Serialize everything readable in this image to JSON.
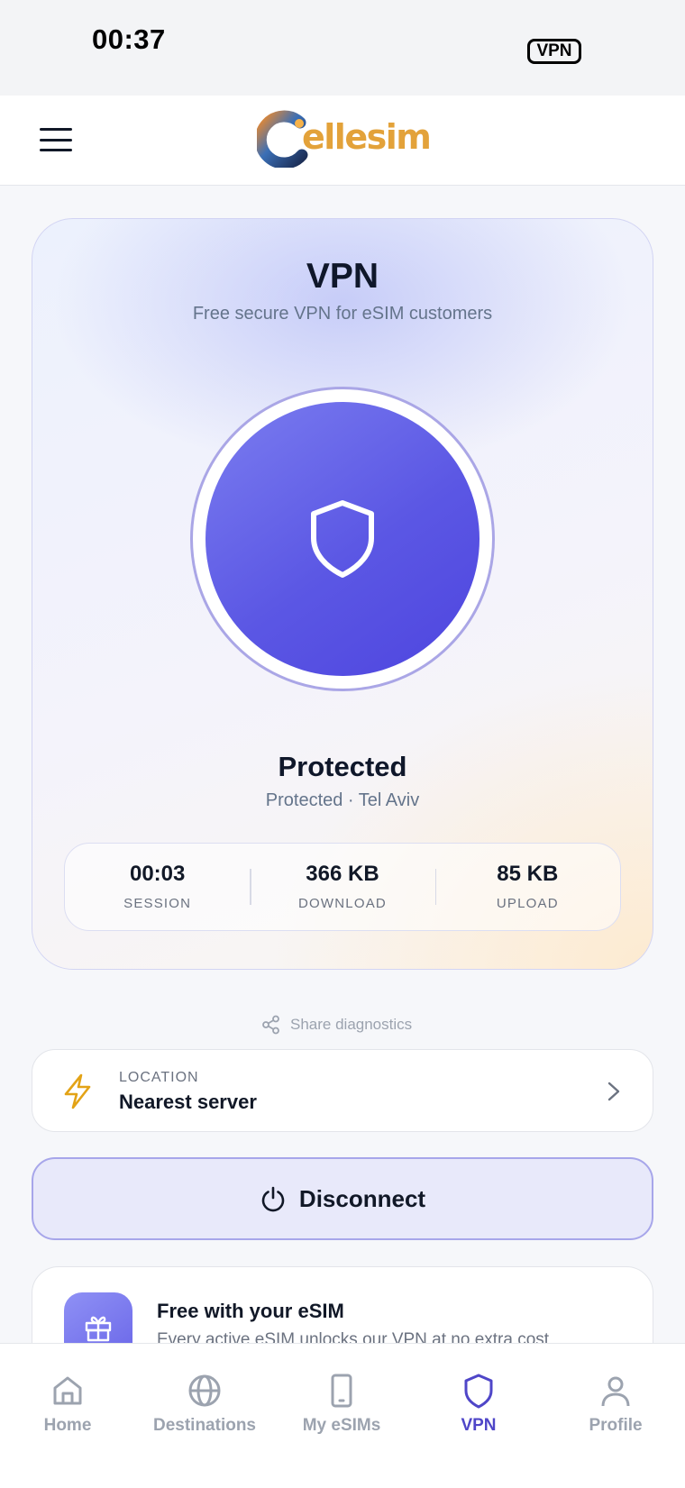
{
  "status_bar": {
    "time": "00:37",
    "vpn_badge": "VPN"
  },
  "header": {
    "logo_text": "ellesim",
    "menu_icon": "hamburger-menu-icon"
  },
  "vpn_card": {
    "title": "VPN",
    "subtitle": "Free secure VPN for eSIM customers",
    "toggle_icon": "shield-icon",
    "state": "Protected",
    "location_line": "Protected · Tel Aviv",
    "stats": [
      {
        "value": "00:03",
        "label": "SESSION"
      },
      {
        "value": "366 KB",
        "label": "DOWNLOAD"
      },
      {
        "value": "85 KB",
        "label": "UPLOAD"
      }
    ],
    "accent_color": "#5b57e4"
  },
  "share_diagnostics": {
    "label": "Share diagnostics",
    "icon": "share-icon"
  },
  "location": {
    "label": "LOCATION",
    "value": "Nearest server",
    "icon": "lightning-icon"
  },
  "disconnect": {
    "label": "Disconnect",
    "icon": "power-icon"
  },
  "promo": {
    "title": "Free with your eSIM",
    "text": "Every active eSIM unlocks our VPN at no extra cost",
    "icon": "gift-icon"
  },
  "tabs": [
    {
      "label": "Home",
      "icon": "home-icon",
      "active": false
    },
    {
      "label": "Destinations",
      "icon": "globe-icon",
      "active": false
    },
    {
      "label": "My eSIMs",
      "icon": "phone-icon",
      "active": false
    },
    {
      "label": "VPN",
      "icon": "shield-icon",
      "active": true
    },
    {
      "label": "Profile",
      "icon": "user-icon",
      "active": false
    }
  ]
}
